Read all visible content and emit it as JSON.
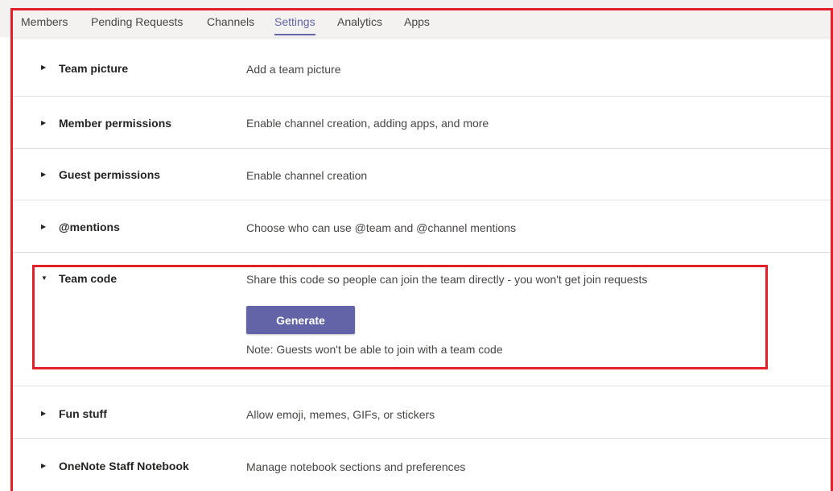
{
  "tabs": [
    {
      "label": "Members"
    },
    {
      "label": "Pending Requests"
    },
    {
      "label": "Channels"
    },
    {
      "label": "Settings",
      "active": true
    },
    {
      "label": "Analytics"
    },
    {
      "label": "Apps"
    }
  ],
  "settings": [
    {
      "title": "Team picture",
      "description": "Add a team picture",
      "expanded": false
    },
    {
      "title": "Member permissions",
      "description": "Enable channel creation, adding apps, and more",
      "expanded": false
    },
    {
      "title": "Guest permissions",
      "description": "Enable channel creation",
      "expanded": false
    },
    {
      "title": "@mentions",
      "description": "Choose who can use @team and @channel mentions",
      "expanded": false
    },
    {
      "title": "Team code",
      "description": "Share this code so people can join the team directly - you won't get join requests",
      "expanded": true,
      "button_label": "Generate",
      "note": "Note: Guests won't be able to join with a team code"
    },
    {
      "title": "Fun stuff",
      "description": "Allow emoji, memes, GIFs, or stickers",
      "expanded": false
    },
    {
      "title": "OneNote Staff Notebook",
      "description": "Manage notebook sections and preferences",
      "expanded": false
    }
  ],
  "colors": {
    "accent": "#6264a7",
    "highlight_border": "#e3202a"
  },
  "icons": {
    "collapsed": "caret-right-icon",
    "expanded": "caret-down-icon"
  }
}
